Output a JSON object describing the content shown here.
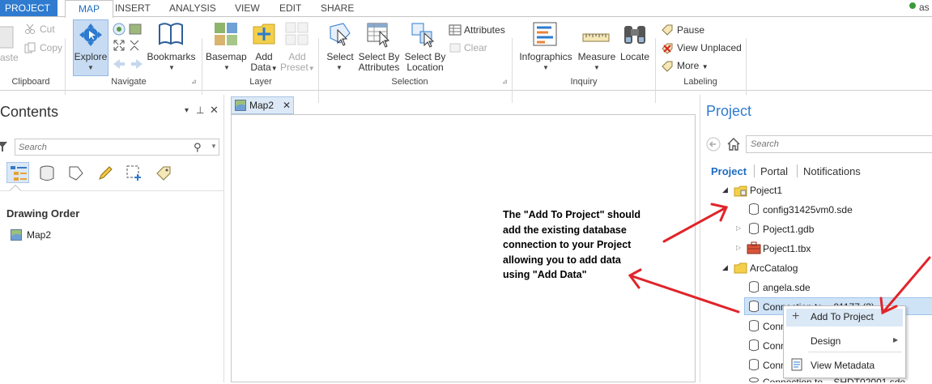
{
  "tabs": {
    "project": "PROJECT",
    "map": "MAP",
    "insert": "INSERT",
    "analysis": "ANALYSIS",
    "view": "VIEW",
    "edit": "EDIT",
    "share": "SHARE",
    "user": "as"
  },
  "ribbon": {
    "clipboard": {
      "paste": "aste",
      "cut": "Cut",
      "copy": "Copy",
      "label": "Clipboard"
    },
    "navigate": {
      "explore": "Explore",
      "bookmarks": "Bookmarks",
      "label": "Navigate"
    },
    "layer": {
      "basemap": "Basemap",
      "add_data_1": "Add",
      "add_data_2": "Data",
      "add_preset_1": "Add",
      "add_preset_2": "Preset",
      "label": "Layer"
    },
    "selection": {
      "select": "Select",
      "by_attr_1": "Select By",
      "by_attr_2": "Attributes",
      "by_loc_1": "Select By",
      "by_loc_2": "Location",
      "attributes": "Attributes",
      "clear": "Clear",
      "label": "Selection"
    },
    "inquiry": {
      "infographics": "Infographics",
      "measure": "Measure",
      "locate": "Locate",
      "label": "Inquiry"
    },
    "labeling": {
      "pause": "Pause",
      "view_unplaced": "View Unplaced",
      "more": "More",
      "label": "Labeling"
    }
  },
  "contents": {
    "title": "Contents",
    "search_placeholder": "Search",
    "drawing_order": "Drawing Order",
    "map_item": "Map2"
  },
  "map_tab": {
    "label": "Map2"
  },
  "project": {
    "title": "Project",
    "search_placeholder": "Search",
    "subtabs": {
      "project": "Project",
      "portal": "Portal",
      "notifications": "Notifications"
    },
    "tree": {
      "poject1": "Poject1",
      "config": "config31425vm0.sde",
      "gdb": "Poject1.gdb",
      "tbx": "Poject1.tbx",
      "arccatalog": "ArcCatalog",
      "angela": "angela.sde",
      "conn1": "Connection to ...01177 (3)...",
      "conn2": "Conn",
      "conn3": "Conn",
      "conn4": "Conn",
      "conn5": "Connection to ...SHDT02001.sde"
    }
  },
  "context_menu": {
    "add_to_project": "Add To Project",
    "design": "Design",
    "view_metadata": "View Metadata"
  },
  "annotation": {
    "line1": "The \"Add To Project\" should",
    "line2": "add the existing database",
    "line3": "connection to your Project",
    "line4": "allowing you to add data",
    "line5": "using \"Add Data\""
  },
  "colors": {
    "accent": "#2e7bcf",
    "arrow": "#e0242a",
    "selected_row": "#cfe3f7"
  }
}
